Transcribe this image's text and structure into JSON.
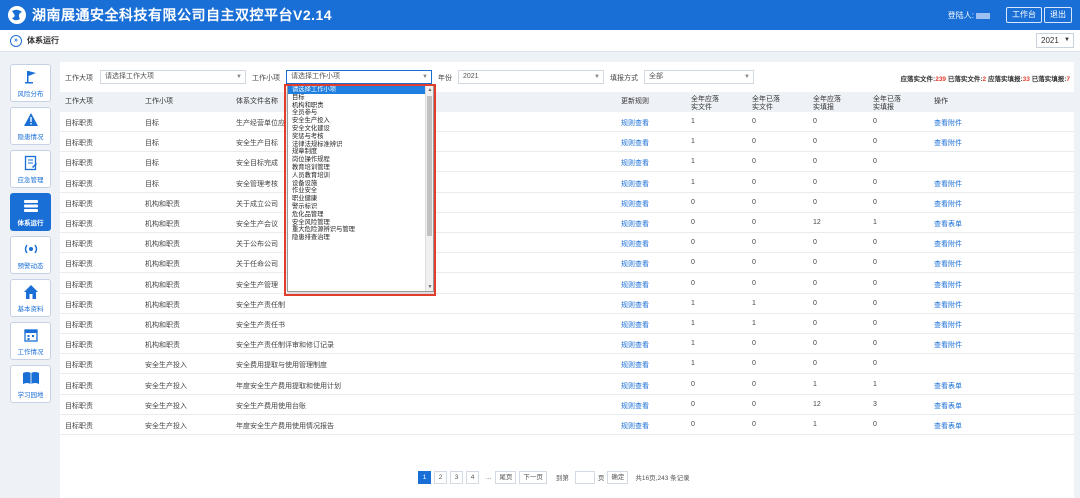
{
  "header": {
    "title": "湖南展通安全科技有限公司自主双控平台V2.14",
    "user_label": "登陆人:",
    "workbench_btn": "工作台",
    "logout_btn": "退出"
  },
  "subbar": {
    "breadcrumb": "体系运行",
    "year": "2021"
  },
  "sidebar": {
    "items": [
      {
        "label": "风险分布",
        "icon": "flag-icon"
      },
      {
        "label": "隐患情况",
        "icon": "warning-icon"
      },
      {
        "label": "应急管理",
        "icon": "document-icon"
      },
      {
        "label": "体系运行",
        "icon": "stack-icon"
      },
      {
        "label": "预警动态",
        "icon": "broadcast-icon"
      },
      {
        "label": "基本资料",
        "icon": "home-icon"
      },
      {
        "label": "工作情况",
        "icon": "calendar-icon"
      },
      {
        "label": "学习园地",
        "icon": "book-icon"
      }
    ]
  },
  "filters": {
    "work_category_label": "工作大项",
    "work_category_value": "请选择工作大项",
    "work_item_label": "工作小项",
    "work_item_value": "请选择工作小项",
    "year_label": "年份",
    "year_value": "2021",
    "method_label": "填报方式",
    "method_value": "全部"
  },
  "stats": {
    "should_files_label": "应落实文件:",
    "should_files": "239",
    "done_files_label": "已落实文件:",
    "done_files": "2",
    "should_records_label": "应落实填报:",
    "should_records": "33",
    "done_records_label": "已落实填报:",
    "done_records": "7"
  },
  "table": {
    "headers": [
      "工作大项",
      "工作小项",
      "体系文件名称",
      "",
      "更新规则",
      "全年应落实文件",
      "全年已落实文件",
      "全年应落实填报",
      "全年已落实填报",
      "操作"
    ],
    "rows": [
      {
        "cat": "目标职责",
        "item": "目标",
        "name": "生产经营单位应",
        "rule": "规则查看",
        "a": "1",
        "b": "0",
        "c": "0",
        "d": "0",
        "op": "查看附件"
      },
      {
        "cat": "目标职责",
        "item": "目标",
        "name": "安全生产目标",
        "rule": "规则查看",
        "a": "1",
        "b": "0",
        "c": "0",
        "d": "0",
        "op": "查看附件"
      },
      {
        "cat": "目标职责",
        "item": "目标",
        "name": "安全目标完成",
        "rule": "规则查看",
        "a": "1",
        "b": "0",
        "c": "0",
        "d": "0",
        "op": ""
      },
      {
        "cat": "目标职责",
        "item": "目标",
        "name": "安全管理考核",
        "rule": "规则查看",
        "a": "1",
        "b": "0",
        "c": "0",
        "d": "0",
        "op": "查看附件"
      },
      {
        "cat": "目标职责",
        "item": "机构和职责",
        "name": "关于成立公司",
        "rule": "规则查看",
        "a": "0",
        "b": "0",
        "c": "0",
        "d": "0",
        "op": "查看附件"
      },
      {
        "cat": "目标职责",
        "item": "机构和职责",
        "name": "安全生产会议",
        "rule": "规则查看",
        "a": "0",
        "b": "0",
        "c": "12",
        "d": "1",
        "op": "查看表单"
      },
      {
        "cat": "目标职责",
        "item": "机构和职责",
        "name": "关于公布公司",
        "rule": "规则查看",
        "a": "0",
        "b": "0",
        "c": "0",
        "d": "0",
        "op": "查看附件"
      },
      {
        "cat": "目标职责",
        "item": "机构和职责",
        "name": "关于任命公司",
        "rule": "规则查看",
        "a": "0",
        "b": "0",
        "c": "0",
        "d": "0",
        "op": "查看附件"
      },
      {
        "cat": "目标职责",
        "item": "机构和职责",
        "name": "安全生产管理",
        "rule": "规则查看",
        "a": "0",
        "b": "0",
        "c": "0",
        "d": "0",
        "op": "查看附件"
      },
      {
        "cat": "目标职责",
        "item": "机构和职责",
        "name": "安全生产责任制",
        "rule": "规则查看",
        "a": "1",
        "b": "1",
        "c": "0",
        "d": "0",
        "op": "查看附件"
      },
      {
        "cat": "目标职责",
        "item": "机构和职责",
        "name": "安全生产责任书",
        "rule": "规则查看",
        "a": "1",
        "b": "1",
        "c": "0",
        "d": "0",
        "op": "查看附件"
      },
      {
        "cat": "目标职责",
        "item": "机构和职责",
        "name": "安全生产责任制评审和修订记录",
        "rule": "规则查看",
        "a": "1",
        "b": "0",
        "c": "0",
        "d": "0",
        "op": "查看附件"
      },
      {
        "cat": "目标职责",
        "item": "安全生产投入",
        "name": "安全费用提取与使用管理制度",
        "rule": "规则查看",
        "a": "1",
        "b": "0",
        "c": "0",
        "d": "0",
        "op": ""
      },
      {
        "cat": "目标职责",
        "item": "安全生产投入",
        "name": "年度安全生产费用提取和使用计划",
        "rule": "规则查看",
        "a": "0",
        "b": "0",
        "c": "1",
        "d": "1",
        "op": "查看表单"
      },
      {
        "cat": "目标职责",
        "item": "安全生产投入",
        "name": "安全生产费用使用台账",
        "rule": "规则查看",
        "a": "0",
        "b": "0",
        "c": "12",
        "d": "3",
        "op": "查看表单"
      },
      {
        "cat": "目标职责",
        "item": "安全生产投入",
        "name": "年度安全生产费用使用情况报告",
        "rule": "规则查看",
        "a": "0",
        "b": "0",
        "c": "1",
        "d": "0",
        "op": "查看表单"
      }
    ]
  },
  "dropdown": {
    "options": [
      "请选择工作小项",
      "目标",
      "机构和职责",
      "全员参与",
      "安全生产投入",
      "安全文化建设",
      "奖惩与考核",
      "法律法规标准辨识",
      "规章制度",
      "岗位操作规程",
      "教育培训管理",
      "人员教育培训",
      "设备设施",
      "作业安全",
      "职业健康",
      "警示标识",
      "危化品管理",
      "安全风险管理",
      "重大危险源辨识与管理",
      "隐患排查治理"
    ]
  },
  "pager": {
    "pages": [
      "1",
      "2",
      "3",
      "4"
    ],
    "ellipsis": "...",
    "first": "尾页",
    "next": "下一页",
    "goto_label": "到第",
    "page_unit": "页",
    "confirm": "确定",
    "summary": "共16页,243 条记录"
  }
}
